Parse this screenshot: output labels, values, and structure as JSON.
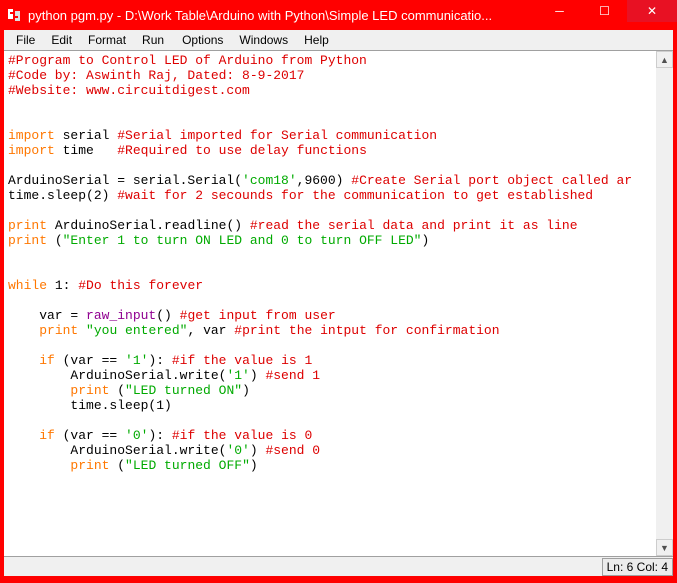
{
  "titlebar": {
    "title": "python pgm.py - D:\\Work Table\\Arduino with Python\\Simple LED communicatio..."
  },
  "menu": {
    "file": "File",
    "edit": "Edit",
    "format": "Format",
    "run": "Run",
    "options": "Options",
    "windows": "Windows",
    "help": "Help"
  },
  "code": {
    "l1": "#Program to Control LED of Arduino from Python",
    "l2": "#Code by: Aswinth Raj, Dated: 8-9-2017",
    "l3": "#Website: www.circuitdigest.com",
    "l4": "",
    "l5": "",
    "l6a": "import",
    "l6b": " serial ",
    "l6c": "#Serial imported for Serial communication",
    "l7a": "import",
    "l7b": " time   ",
    "l7c": "#Required to use delay functions",
    "l8": "",
    "l9a": "ArduinoSerial = serial.Serial(",
    "l9b": "'com18'",
    "l9c": ",9600) ",
    "l9d": "#Create Serial port object called ar",
    "l10a": "time.sleep(2) ",
    "l10b": "#wait for 2 secounds for the communication to get established",
    "l11": "",
    "l12a": "print",
    "l12b": " ArduinoSerial.readline() ",
    "l12c": "#read the serial data and print it as line",
    "l13a": "print",
    "l13b": " (",
    "l13c": "\"Enter 1 to turn ON LED and 0 to turn OFF LED\"",
    "l13d": ")",
    "l14": "",
    "l15": "",
    "l16a": "while",
    "l16b": " 1: ",
    "l16c": "#Do this forever",
    "l17": "",
    "l18a": "    var = ",
    "l18b": "raw_input",
    "l18c": "() ",
    "l18d": "#get input from user",
    "l19a": "    ",
    "l19b": "print",
    "l19c": " ",
    "l19d": "\"you entered\"",
    "l19e": ", var ",
    "l19f": "#print the intput for confirmation",
    "l20": "    ",
    "l21a": "    ",
    "l21b": "if",
    "l21c": " (var == ",
    "l21d": "'1'",
    "l21e": "): ",
    "l21f": "#if the value is 1",
    "l22a": "        ArduinoSerial.write(",
    "l22b": "'1'",
    "l22c": ") ",
    "l22d": "#send 1",
    "l23a": "        ",
    "l23b": "print",
    "l23c": " (",
    "l23d": "\"LED turned ON\"",
    "l23e": ")",
    "l24": "        time.sleep(1)",
    "l25": "    ",
    "l26a": "    ",
    "l26b": "if",
    "l26c": " (var == ",
    "l26d": "'0'",
    "l26e": "): ",
    "l26f": "#if the value is 0",
    "l27a": "        ArduinoSerial.write(",
    "l27b": "'0'",
    "l27c": ") ",
    "l27d": "#send 0",
    "l28a": "        ",
    "l28b": "print",
    "l28c": " (",
    "l28d": "\"LED turned OFF\"",
    "l28e": ")"
  },
  "status": {
    "lncol": "Ln: 6 Col: 4"
  },
  "scroll": {
    "up": "▲",
    "down": "▼"
  }
}
